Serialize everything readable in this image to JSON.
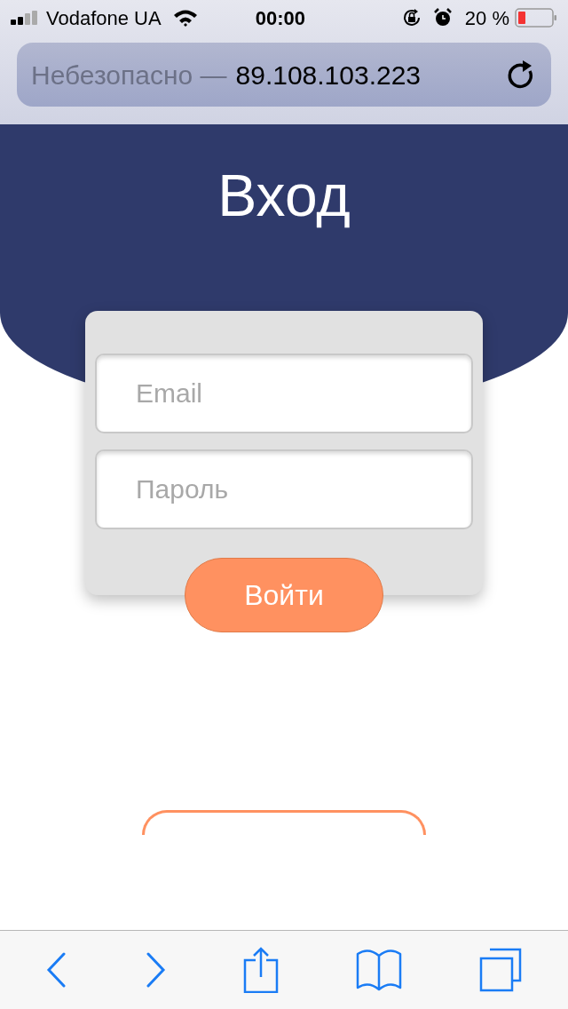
{
  "status_bar": {
    "carrier": "Vodafone UA",
    "time": "00:00",
    "battery": "20 %"
  },
  "address_bar": {
    "security": "Небезопасно —",
    "address": "89.108.103.223"
  },
  "page": {
    "title": "Вход",
    "fields": [
      {
        "placeholder": "Email"
      },
      {
        "placeholder": "Пароль"
      }
    ],
    "submit": "Войти"
  }
}
